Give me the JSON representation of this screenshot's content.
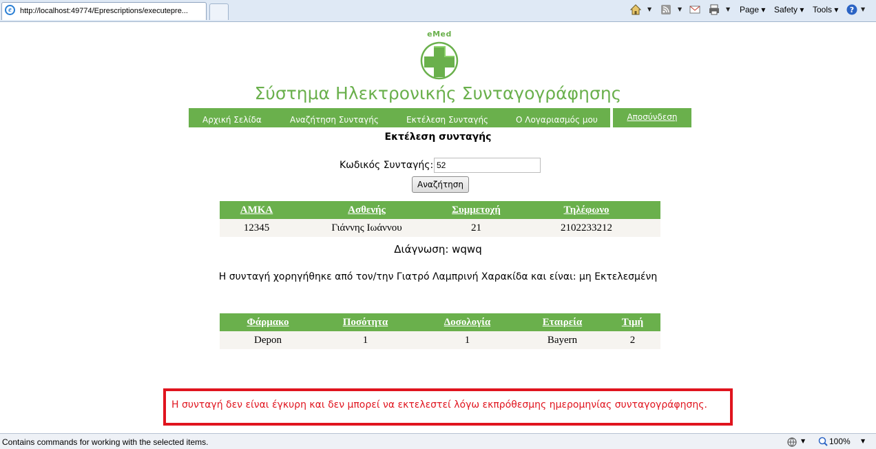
{
  "browser": {
    "tab_url": "http://localhost:49774/Eprescriptions/executepre...",
    "toolbar": {
      "page": "Page",
      "safety": "Safety",
      "tools": "Tools"
    },
    "status_text": "Contains commands for working with the selected items.",
    "zoom": "100%"
  },
  "site": {
    "logo_text": "eMed",
    "title": "Σύστημα Ηλεκτρονικής Συνταγογράφησης",
    "nav": [
      "Αρχική Σελίδα",
      "Αναζήτηση Συνταγής",
      "Εκτέλεση Συνταγής",
      "Ο Λογαριασμός μου"
    ],
    "logout": "Αποσύνδεση",
    "accent": "#6ab04c"
  },
  "main": {
    "heading": "Εκτέλεση συνταγής",
    "code_label": "Κωδικός Συνταγής:",
    "code_value": "52",
    "search_button": "Αναζήτηση",
    "patient_table": {
      "headers": [
        "ΑΜΚΑ",
        "Ασθενής",
        "Συμμετοχή",
        "Τηλέφωνο"
      ],
      "row": [
        "12345",
        "Γιάννης Ιωάννου",
        "21",
        "2102233212"
      ]
    },
    "diagnosis": "Διάγνωση: wqwq",
    "issued_by": "Η συνταγή χορηγήθηκε από τον/την Γιατρό Λαμπρινή Χαρακίδα και είναι: μη Εκτελεσμένη",
    "drug_table": {
      "headers": [
        "Φάρμακο",
        "Ποσότητα",
        "Δοσολογία",
        "Εταιρεία",
        "Τιμή"
      ],
      "row": [
        "Depon",
        "1",
        "1",
        "Bayern",
        "2"
      ]
    },
    "error_message": "Η συνταγή δεν είναι έγκυρη και δεν μπορεί να εκτελεστεί λόγω εκπρόθεσμης ημερομηνίας συνταγογράφησης.",
    "error_color": "#e0141e"
  }
}
